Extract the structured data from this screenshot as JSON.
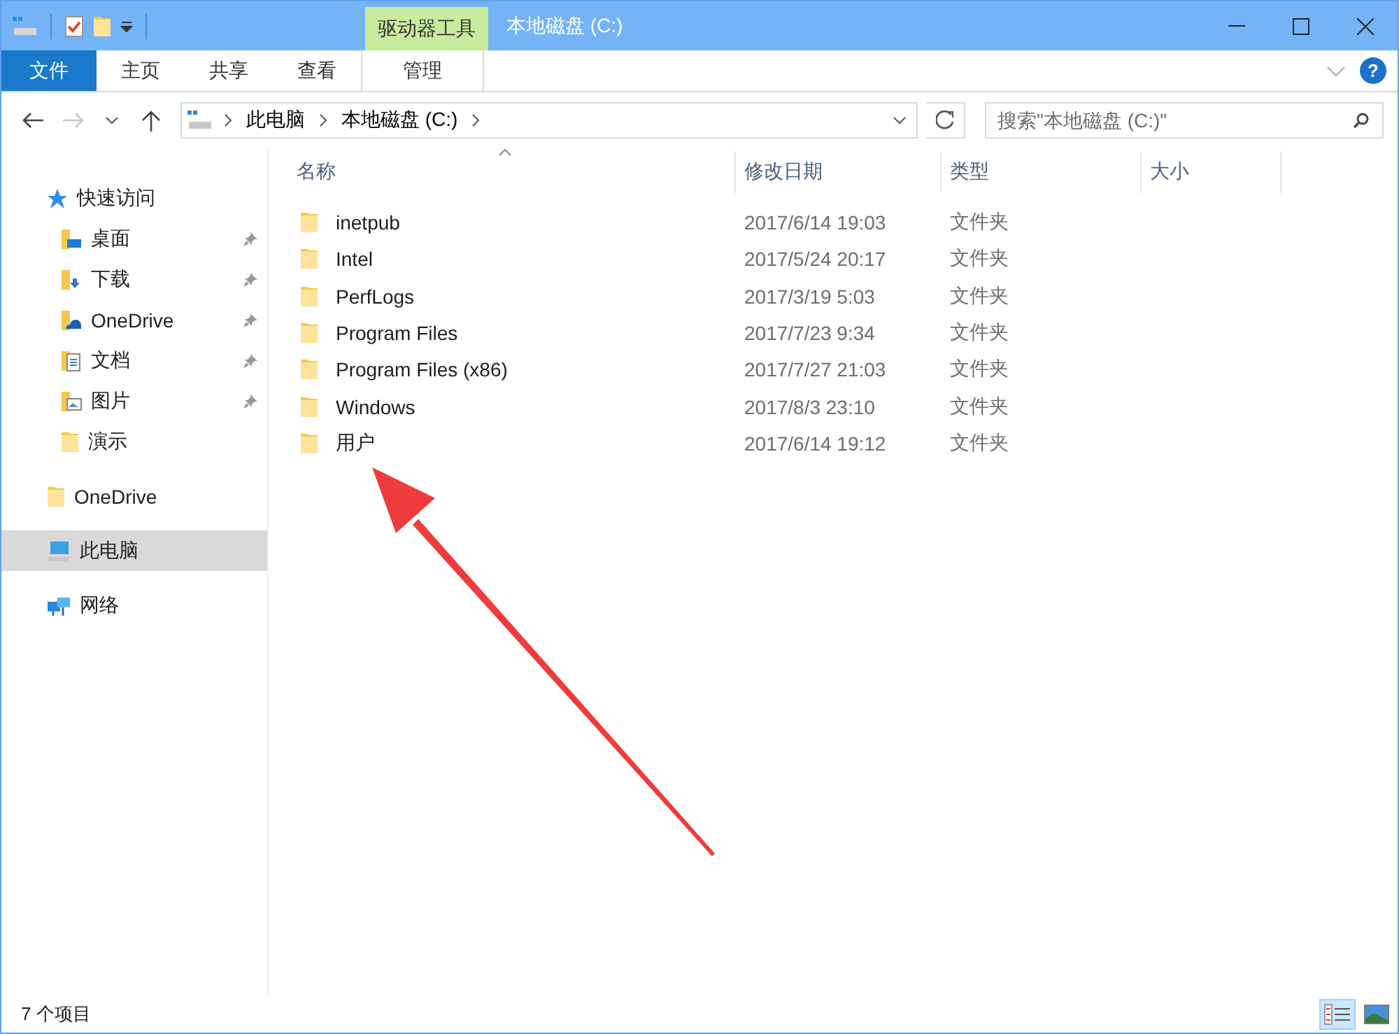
{
  "window": {
    "title": "本地磁盘 (C:)",
    "context_tab_group": "驱动器工具"
  },
  "ribbon": {
    "tabs": [
      {
        "label": "文件",
        "kind": "file"
      },
      {
        "label": "主页",
        "kind": "normal"
      },
      {
        "label": "共享",
        "kind": "normal"
      },
      {
        "label": "查看",
        "kind": "normal"
      },
      {
        "label": "管理",
        "kind": "context"
      }
    ]
  },
  "address_bar": {
    "path": [
      "此电脑",
      "本地磁盘 (C:)"
    ]
  },
  "help_button": "?",
  "search": {
    "placeholder": "搜索\"本地磁盘 (C:)\""
  },
  "sidebar": {
    "items": [
      {
        "label": "快速访问",
        "kind": "star",
        "selected": false,
        "children": [
          {
            "label": "桌面",
            "kind": "desktop",
            "pinned": true
          },
          {
            "label": "下载",
            "kind": "download",
            "pinned": true
          },
          {
            "label": "OneDrive",
            "kind": "cloud",
            "pinned": true
          },
          {
            "label": "文档",
            "kind": "document",
            "pinned": true
          },
          {
            "label": "图片",
            "kind": "picture",
            "pinned": true
          },
          {
            "label": "演示",
            "kind": "folder",
            "pinned": false
          }
        ]
      },
      {
        "label": "OneDrive",
        "kind": "folder",
        "selected": false
      },
      {
        "label": "此电脑",
        "kind": "computer",
        "selected": true
      },
      {
        "label": "网络",
        "kind": "network",
        "selected": false
      }
    ]
  },
  "file_list": {
    "columns": [
      "名称",
      "修改日期",
      "类型",
      "大小"
    ],
    "rows": [
      {
        "name": "inetpub",
        "modified": "2017/6/14 19:03",
        "type": "文件夹"
      },
      {
        "name": "Intel",
        "modified": "2017/5/24 20:17",
        "type": "文件夹"
      },
      {
        "name": "PerfLogs",
        "modified": "2017/3/19 5:03",
        "type": "文件夹"
      },
      {
        "name": "Program Files",
        "modified": "2017/7/23 9:34",
        "type": "文件夹"
      },
      {
        "name": "Program Files (x86)",
        "modified": "2017/7/27 21:03",
        "type": "文件夹"
      },
      {
        "name": "Windows",
        "modified": "2017/8/3 23:10",
        "type": "文件夹"
      },
      {
        "name": "用户",
        "modified": "2017/6/14 19:12",
        "type": "文件夹"
      }
    ]
  },
  "status_bar": {
    "item_count": "7 个项目",
    "view_buttons": [
      {
        "kind": "details",
        "selected": true
      },
      {
        "kind": "thumbnails",
        "selected": false
      }
    ]
  }
}
